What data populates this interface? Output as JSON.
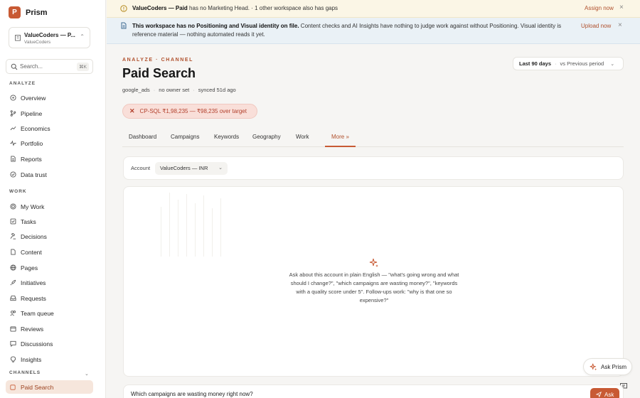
{
  "brand": {
    "logo_letter": "P",
    "name": "Prism"
  },
  "workspace": {
    "name": "ValueCoders — P...",
    "sub": "ValueCoders"
  },
  "search": {
    "placeholder": "Search...",
    "shortcut": "⌘K"
  },
  "sidebar": {
    "analyze_label": "ANALYZE",
    "analyze_items": [
      {
        "label": "Overview",
        "icon": "circle-dot-icon"
      },
      {
        "label": "Pipeline",
        "icon": "branch-icon"
      },
      {
        "label": "Economics",
        "icon": "trend-icon"
      },
      {
        "label": "Portfolio",
        "icon": "pulse-icon"
      },
      {
        "label": "Reports",
        "icon": "document-icon"
      },
      {
        "label": "Data trust",
        "icon": "check-circle-icon"
      }
    ],
    "work_label": "WORK",
    "work_items": [
      {
        "label": "My Work",
        "icon": "target-icon"
      },
      {
        "label": "Tasks",
        "icon": "checkbox-icon"
      },
      {
        "label": "Decisions",
        "icon": "gavel-icon"
      },
      {
        "label": "Content",
        "icon": "file-icon"
      },
      {
        "label": "Pages",
        "icon": "globe-icon"
      },
      {
        "label": "Initiatives",
        "icon": "rocket-icon"
      },
      {
        "label": "Requests",
        "icon": "inbox-icon"
      },
      {
        "label": "Team queue",
        "icon": "users-icon"
      },
      {
        "label": "Reviews",
        "icon": "calendar-icon"
      },
      {
        "label": "Discussions",
        "icon": "message-icon"
      },
      {
        "label": "Insights",
        "icon": "bulb-icon"
      }
    ],
    "channels_label": "CHANNELS",
    "channel_items": [
      {
        "label": "Paid Search",
        "icon": "ad-icon"
      }
    ]
  },
  "banner1": {
    "bold": "ValueCoders — Paid",
    "text": "has no Marketing Head. · 1 other workspace also has gaps",
    "action": "Assign now",
    "close": "×"
  },
  "banner2": {
    "bold": "This workspace has no Positioning and Visual identity on file.",
    "text": "Content checks and AI Insights have nothing to judge work against without Positioning. Visual identity is reference material — nothing automated reads it yet.",
    "action": "Upload now",
    "close": "×"
  },
  "header": {
    "breadcrumb": "ANALYZE · CHANNEL",
    "title": "Paid Search",
    "meta": [
      "google_ads",
      "no owner set",
      "synced 51d ago"
    ],
    "period_primary": "Last 90 days",
    "period_secondary": "vs Previous period"
  },
  "alert": {
    "text": "CP-SQL ₹1,98,235 — ₹98,235 over target"
  },
  "tabs": [
    "Dashboard",
    "Campaigns",
    "Keywords",
    "Geography",
    "Work",
    "More »"
  ],
  "active_tab": "More »",
  "account": {
    "label": "Account",
    "value": "ValueCoders — INR"
  },
  "chat": {
    "hint": "Ask about this account in plain English — \"what's going wrong and what should I change?\", \"which campaigns are wasting money?\", \"keywords with a quality score under 5\". Follow-ups work: \"why is that one so expensive?\"",
    "ask_prism": "Ask Prism",
    "input_value": "Which campaigns are wasting money right now?",
    "ask_button": "Ask"
  },
  "colors": {
    "accent": "#c85a34",
    "alert_bg": "#f9dfd9",
    "banner_warn": "#fbf6e6",
    "banner_info": "#eaf1f6"
  }
}
